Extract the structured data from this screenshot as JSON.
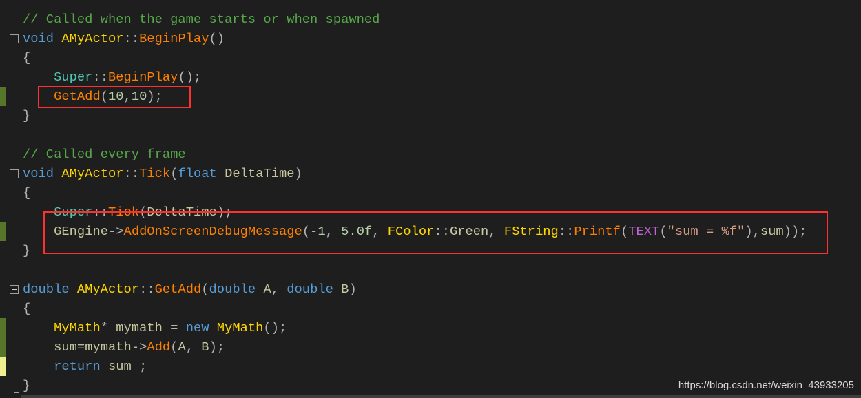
{
  "editor": {
    "colors": {
      "comment": "#57a64a",
      "keyword": "#569cd6",
      "class": "#ffd700",
      "function": "#ff8000",
      "highlight_box": "#ff3030",
      "change_saved": "#57762a",
      "change_unsaved": "#efef90"
    },
    "lines": [
      [
        [
          "// Called when the game starts or when spawned",
          "comment"
        ]
      ],
      [
        [
          "void",
          "kw"
        ],
        [
          " ",
          "punc"
        ],
        [
          "AMyActor",
          "cls"
        ],
        [
          "::",
          "punc"
        ],
        [
          "BeginPlay",
          "fn"
        ],
        [
          "()",
          "punc"
        ]
      ],
      [
        [
          "{",
          "punc"
        ]
      ],
      [
        [
          "    ",
          "punc"
        ],
        [
          "Super",
          "super"
        ],
        [
          "::",
          "punc"
        ],
        [
          "BeginPlay",
          "fn"
        ],
        [
          "();",
          "punc"
        ]
      ],
      [
        [
          "    ",
          "punc"
        ],
        [
          "GetAdd",
          "fn"
        ],
        [
          "(",
          "punc"
        ],
        [
          "10",
          "num"
        ],
        [
          ",",
          "punc"
        ],
        [
          "10",
          "num"
        ],
        [
          ");",
          "punc"
        ]
      ],
      [
        [
          "}",
          "punc"
        ]
      ],
      [],
      [
        [
          "// Called every frame",
          "comment"
        ]
      ],
      [
        [
          "void",
          "kw"
        ],
        [
          " ",
          "punc"
        ],
        [
          "AMyActor",
          "cls"
        ],
        [
          "::",
          "punc"
        ],
        [
          "Tick",
          "fn"
        ],
        [
          "(",
          "punc"
        ],
        [
          "float",
          "kw"
        ],
        [
          " ",
          "punc"
        ],
        [
          "DeltaTime",
          "param"
        ],
        [
          ")",
          "punc"
        ]
      ],
      [
        [
          "{",
          "punc"
        ]
      ],
      [
        [
          "    ",
          "punc"
        ],
        [
          "Super",
          "super"
        ],
        [
          "::",
          "punc"
        ],
        [
          "Tick",
          "fn"
        ],
        [
          "(",
          "punc"
        ],
        [
          "DeltaTime",
          "param"
        ],
        [
          ");",
          "punc"
        ]
      ],
      [
        [
          "    ",
          "punc"
        ],
        [
          "GEngine",
          "var"
        ],
        [
          "->",
          "punc"
        ],
        [
          "AddOnScreenDebugMessage",
          "fn"
        ],
        [
          "(-",
          "punc"
        ],
        [
          "1",
          "num"
        ],
        [
          ", ",
          "punc"
        ],
        [
          "5.0f",
          "num"
        ],
        [
          ", ",
          "punc"
        ],
        [
          "FColor",
          "cls"
        ],
        [
          "::",
          "punc"
        ],
        [
          "Green",
          "var"
        ],
        [
          ", ",
          "punc"
        ],
        [
          "FString",
          "cls"
        ],
        [
          "::",
          "punc"
        ],
        [
          "Printf",
          "fn"
        ],
        [
          "(",
          "punc"
        ],
        [
          "TEXT",
          "macro"
        ],
        [
          "(",
          "punc"
        ],
        [
          "\"sum = %f\"",
          "str"
        ],
        [
          "),",
          "punc"
        ],
        [
          "sum",
          "var"
        ],
        [
          "));",
          "punc"
        ]
      ],
      [
        [
          "}",
          "punc"
        ]
      ],
      [],
      [
        [
          "double",
          "kw"
        ],
        [
          " ",
          "punc"
        ],
        [
          "AMyActor",
          "cls"
        ],
        [
          "::",
          "punc"
        ],
        [
          "GetAdd",
          "fn"
        ],
        [
          "(",
          "punc"
        ],
        [
          "double",
          "kw"
        ],
        [
          " ",
          "punc"
        ],
        [
          "A",
          "param"
        ],
        [
          ", ",
          "punc"
        ],
        [
          "double",
          "kw"
        ],
        [
          " ",
          "punc"
        ],
        [
          "B",
          "param"
        ],
        [
          ")",
          "punc"
        ]
      ],
      [
        [
          "{",
          "punc"
        ]
      ],
      [
        [
          "    ",
          "punc"
        ],
        [
          "MyMath",
          "cls"
        ],
        [
          "* ",
          "punc"
        ],
        [
          "mymath",
          "var"
        ],
        [
          " = ",
          "punc"
        ],
        [
          "new",
          "kw"
        ],
        [
          " ",
          "punc"
        ],
        [
          "MyMath",
          "cls"
        ],
        [
          "();",
          "punc"
        ]
      ],
      [
        [
          "    ",
          "punc"
        ],
        [
          "sum",
          "var"
        ],
        [
          "=",
          "punc"
        ],
        [
          "mymath",
          "var"
        ],
        [
          "->",
          "punc"
        ],
        [
          "Add",
          "fn"
        ],
        [
          "(",
          "punc"
        ],
        [
          "A",
          "param"
        ],
        [
          ", ",
          "punc"
        ],
        [
          "B",
          "param"
        ],
        [
          ");",
          "punc"
        ]
      ],
      [
        [
          "    ",
          "punc"
        ],
        [
          "return",
          "kw"
        ],
        [
          " ",
          "punc"
        ],
        [
          "sum",
          "var"
        ],
        [
          " ;",
          "punc"
        ]
      ],
      [
        [
          "}",
          "punc"
        ]
      ]
    ],
    "change_markers": [
      {
        "line": 5,
        "state": "saved"
      },
      {
        "line": 12,
        "state": "saved"
      },
      {
        "line": 17,
        "state": "saved"
      },
      {
        "line": 18,
        "state": "saved"
      },
      {
        "line": 19,
        "state": "unsaved"
      }
    ],
    "fold_lines": [
      2,
      9,
      15
    ]
  },
  "watermark": "https://blog.csdn.net/weixin_43933205"
}
